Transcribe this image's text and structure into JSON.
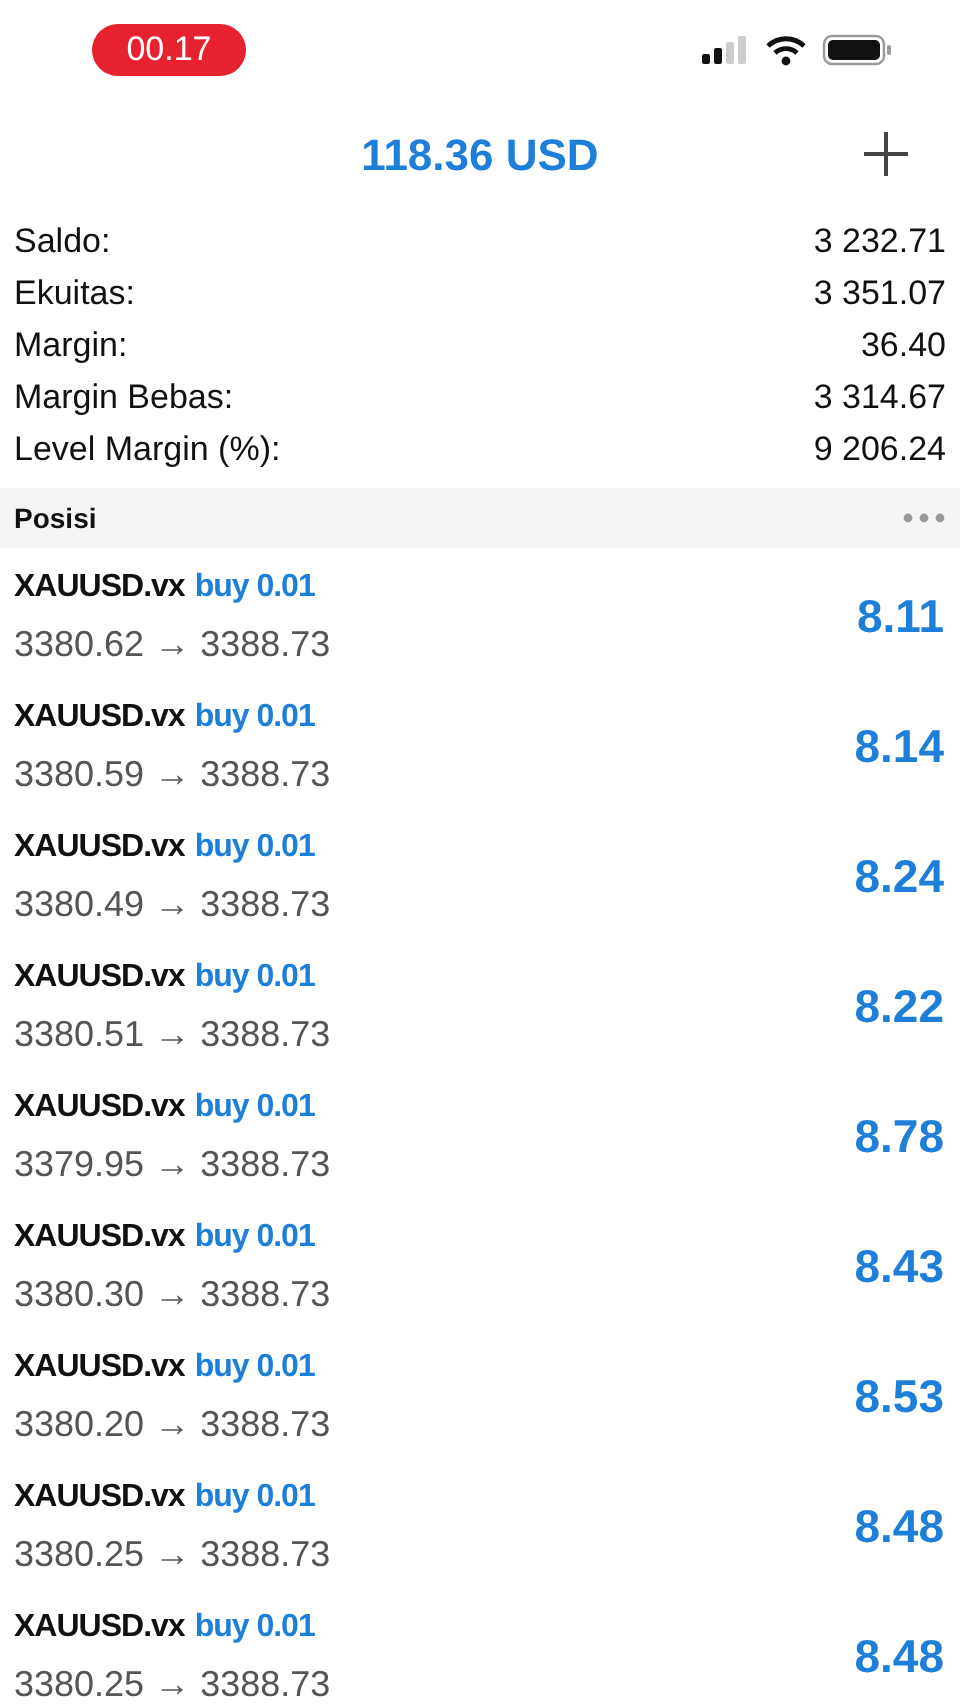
{
  "status_bar": {
    "time": "00.17"
  },
  "header": {
    "title": "118.36 USD"
  },
  "summary": [
    {
      "label": "Saldo:",
      "value": "3 232.71"
    },
    {
      "label": "Ekuitas:",
      "value": "3 351.07"
    },
    {
      "label": "Margin:",
      "value": "36.40"
    },
    {
      "label": "Margin Bebas:",
      "value": "3 314.67"
    },
    {
      "label": "Level Margin (%):",
      "value": "9 206.24"
    }
  ],
  "section": {
    "title": "Posisi"
  },
  "positions": [
    {
      "symbol": "XAUUSD.vx",
      "order": "buy 0.01",
      "prices": "3380.62 → 3388.73",
      "profit": "8.11"
    },
    {
      "symbol": "XAUUSD.vx",
      "order": "buy 0.01",
      "prices": "3380.59 → 3388.73",
      "profit": "8.14"
    },
    {
      "symbol": "XAUUSD.vx",
      "order": "buy 0.01",
      "prices": "3380.49 → 3388.73",
      "profit": "8.24"
    },
    {
      "symbol": "XAUUSD.vx",
      "order": "buy 0.01",
      "prices": "3380.51 → 3388.73",
      "profit": "8.22"
    },
    {
      "symbol": "XAUUSD.vx",
      "order": "buy 0.01",
      "prices": "3379.95 → 3388.73",
      "profit": "8.78"
    },
    {
      "symbol": "XAUUSD.vx",
      "order": "buy 0.01",
      "prices": "3380.30 → 3388.73",
      "profit": "8.43"
    },
    {
      "symbol": "XAUUSD.vx",
      "order": "buy 0.01",
      "prices": "3380.20 → 3388.73",
      "profit": "8.53"
    },
    {
      "symbol": "XAUUSD.vx",
      "order": "buy 0.01",
      "prices": "3380.25 → 3388.73",
      "profit": "8.48"
    },
    {
      "symbol": "XAUUSD.vx",
      "order": "buy 0.01",
      "prices": "3380.25 → 3388.73",
      "profit": "8.48"
    }
  ]
}
